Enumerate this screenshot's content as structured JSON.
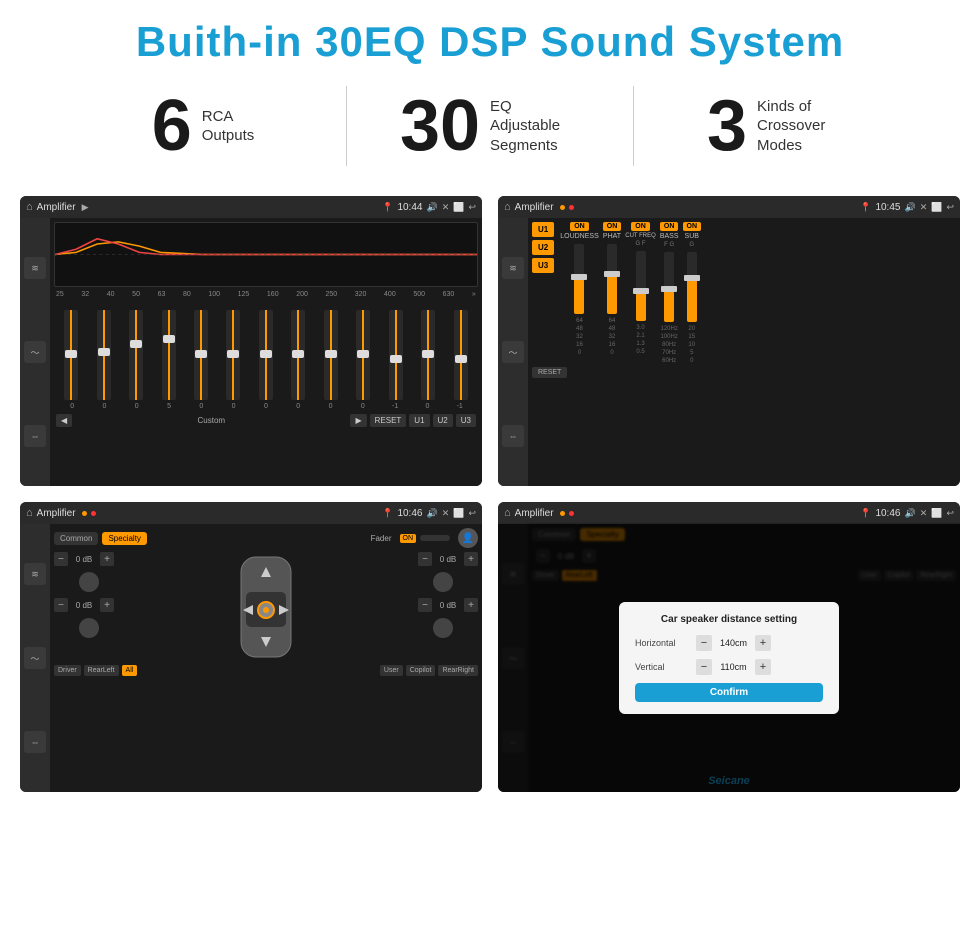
{
  "header": {
    "title": "Buith-in 30EQ DSP Sound System"
  },
  "stats": [
    {
      "number": "6",
      "text_line1": "RCA",
      "text_line2": "Outputs"
    },
    {
      "number": "30",
      "text_line1": "EQ Adjustable",
      "text_line2": "Segments"
    },
    {
      "number": "3",
      "text_line1": "Kinds of",
      "text_line2": "Crossover Modes"
    }
  ],
  "screens": {
    "screen1": {
      "title": "Amplifier",
      "time": "10:44",
      "eq_labels": [
        "25",
        "32",
        "40",
        "50",
        "63",
        "80",
        "100",
        "125",
        "160",
        "200",
        "250",
        "320",
        "400",
        "500",
        "630"
      ],
      "eq_values": [
        "0",
        "0",
        "0",
        "5",
        "0",
        "0",
        "0",
        "0",
        "0",
        "0",
        "-1",
        "0",
        "-1"
      ],
      "bottom_buttons": [
        "◀",
        "Custom",
        "▶",
        "RESET",
        "U1",
        "U2",
        "U3"
      ]
    },
    "screen2": {
      "title": "Amplifier",
      "time": "10:45",
      "u_buttons": [
        "U1",
        "U2",
        "U3"
      ],
      "controls": [
        "LOUDNESS",
        "PHAT",
        "CUT FREQ",
        "BASS",
        "SUB"
      ],
      "reset_label": "RESET"
    },
    "screen3": {
      "title": "Amplifier",
      "time": "10:46",
      "tabs": [
        "Common",
        "Specialty"
      ],
      "fader_label": "Fader",
      "fader_on": "ON",
      "db_values": [
        "0 dB",
        "0 dB",
        "0 dB",
        "0 dB"
      ],
      "bottom_buttons": [
        "Driver",
        "RearLeft",
        "All",
        "User",
        "Copilot",
        "RearRight"
      ]
    },
    "screen4": {
      "title": "Amplifier",
      "time": "10:46",
      "tabs": [
        "Common",
        "Specialty"
      ],
      "dialog": {
        "title": "Car speaker distance setting",
        "horizontal_label": "Horizontal",
        "horizontal_value": "140cm",
        "vertical_label": "Vertical",
        "vertical_value": "110cm",
        "confirm_label": "Confirm"
      },
      "bottom_buttons": [
        "Driver",
        "RearLeft",
        "All",
        "User",
        "Copilot",
        "RearRight"
      ]
    }
  },
  "watermark": "Seicane"
}
